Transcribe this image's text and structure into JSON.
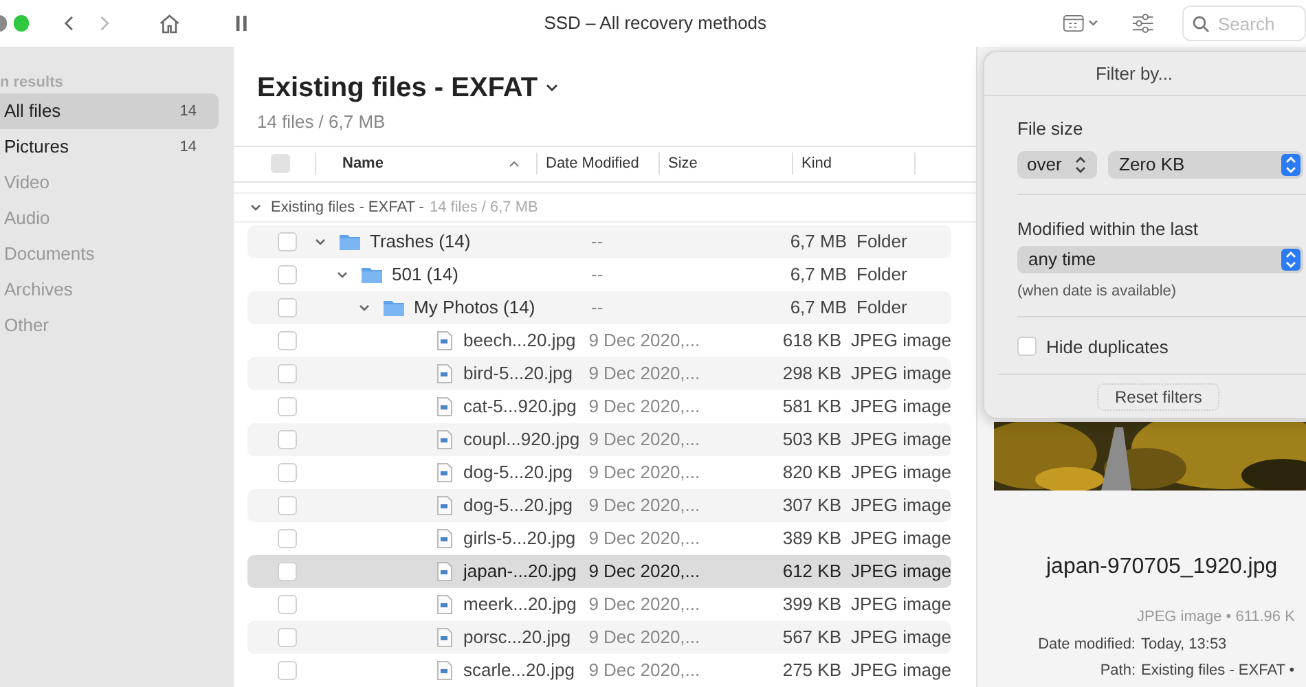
{
  "window": {
    "title": "SSD – All recovery methods"
  },
  "toolbar": {
    "search": {
      "placeholder": "Search"
    }
  },
  "sidebar": {
    "heading": "n results",
    "items": [
      {
        "label": "All files",
        "count": "14",
        "selected": true,
        "disabled": false
      },
      {
        "label": "Pictures",
        "count": "14",
        "selected": false,
        "disabled": false
      },
      {
        "label": "Video",
        "selected": false,
        "disabled": true
      },
      {
        "label": "Audio",
        "selected": false,
        "disabled": true
      },
      {
        "label": "Documents",
        "selected": false,
        "disabled": true
      },
      {
        "label": "Archives",
        "selected": false,
        "disabled": true
      },
      {
        "label": "Other",
        "selected": false,
        "disabled": true
      }
    ]
  },
  "header": {
    "title": "Existing files - EXFAT",
    "subtitle": "14 files / 6,7 MB"
  },
  "table": {
    "select_all": {
      "disabled": true
    },
    "columns": [
      "Name",
      "Date Modified",
      "Size",
      "Kind"
    ],
    "group": {
      "label": "Existing files - EXFAT -",
      "summary": "14 files / 6,7 MB",
      "expanded": true
    },
    "rows": [
      {
        "kind": "folder",
        "name": "Trashes (14)",
        "date": "--",
        "size": "6,7 MB",
        "type": "Folder",
        "expanded": true,
        "selected": false,
        "checked": false,
        "children": [
          {
            "kind": "folder",
            "name": "501 (14)",
            "date": "--",
            "size": "6,7 MB",
            "type": "Folder",
            "expanded": true,
            "selected": false,
            "checked": false,
            "children": [
              {
                "kind": "folder",
                "name": "My Photos (14)",
                "date": "--",
                "size": "6,7 MB",
                "type": "Folder",
                "expanded": true,
                "selected": false,
                "checked": false,
                "children": [
                  {
                    "kind": "file",
                    "name": "beech...20.jpg",
                    "date": "9 Dec 2020,...",
                    "size": "618 KB",
                    "type": "JPEG image",
                    "selected": false,
                    "checked": false
                  },
                  {
                    "kind": "file",
                    "name": "bird-5...20.jpg",
                    "date": "9 Dec 2020,...",
                    "size": "298 KB",
                    "type": "JPEG image",
                    "selected": false,
                    "checked": false
                  },
                  {
                    "kind": "file",
                    "name": "cat-5...920.jpg",
                    "date": "9 Dec 2020,...",
                    "size": "581 KB",
                    "type": "JPEG image",
                    "selected": false,
                    "checked": false
                  },
                  {
                    "kind": "file",
                    "name": "coupl...920.jpg",
                    "date": "9 Dec 2020,...",
                    "size": "503 KB",
                    "type": "JPEG image",
                    "selected": false,
                    "checked": false
                  },
                  {
                    "kind": "file",
                    "name": "dog-5...20.jpg",
                    "date": "9 Dec 2020,...",
                    "size": "820 KB",
                    "type": "JPEG image",
                    "selected": false,
                    "checked": false
                  },
                  {
                    "kind": "file",
                    "name": "dog-5...20.jpg",
                    "date": "9 Dec 2020,...",
                    "size": "307 KB",
                    "type": "JPEG image",
                    "selected": false,
                    "checked": false
                  },
                  {
                    "kind": "file",
                    "name": "girls-5...20.jpg",
                    "date": "9 Dec 2020,...",
                    "size": "389 KB",
                    "type": "JPEG image",
                    "selected": false,
                    "checked": false
                  },
                  {
                    "kind": "file",
                    "name": "japan-...20.jpg",
                    "date": "9 Dec 2020,...",
                    "size": "612 KB",
                    "type": "JPEG image",
                    "selected": true,
                    "checked": false
                  },
                  {
                    "kind": "file",
                    "name": "meerk...20.jpg",
                    "date": "9 Dec 2020,...",
                    "size": "399 KB",
                    "type": "JPEG image",
                    "selected": false,
                    "checked": false
                  },
                  {
                    "kind": "file",
                    "name": "porsc...20.jpg",
                    "date": "9 Dec 2020,...",
                    "size": "567 KB",
                    "type": "JPEG image",
                    "selected": false,
                    "checked": false
                  },
                  {
                    "kind": "file",
                    "name": "scarle...20.jpg",
                    "date": "9 Dec 2020,...",
                    "size": "275 KB",
                    "type": "JPEG image",
                    "selected": false,
                    "checked": false
                  }
                ]
              }
            ]
          }
        ]
      }
    ]
  },
  "filter_popover": {
    "title": "Filter by...",
    "file_size_label": "File size",
    "comparison": "over",
    "size_value": "Zero KB",
    "modified_label": "Modified within the last",
    "modified_value": "any time",
    "modified_note": "(when date is available)",
    "hide_duplicates": {
      "label": "Hide duplicates",
      "checked": false
    },
    "reset_button": "Reset filters"
  },
  "preview": {
    "filename": "japan-970705_1920.jpg",
    "info": "JPEG image • 611.96 K",
    "details": [
      {
        "label": "Date modified:",
        "value": "Today, 13:53"
      },
      {
        "label": "Path:",
        "value": "Existing files - EXFAT •"
      }
    ]
  }
}
